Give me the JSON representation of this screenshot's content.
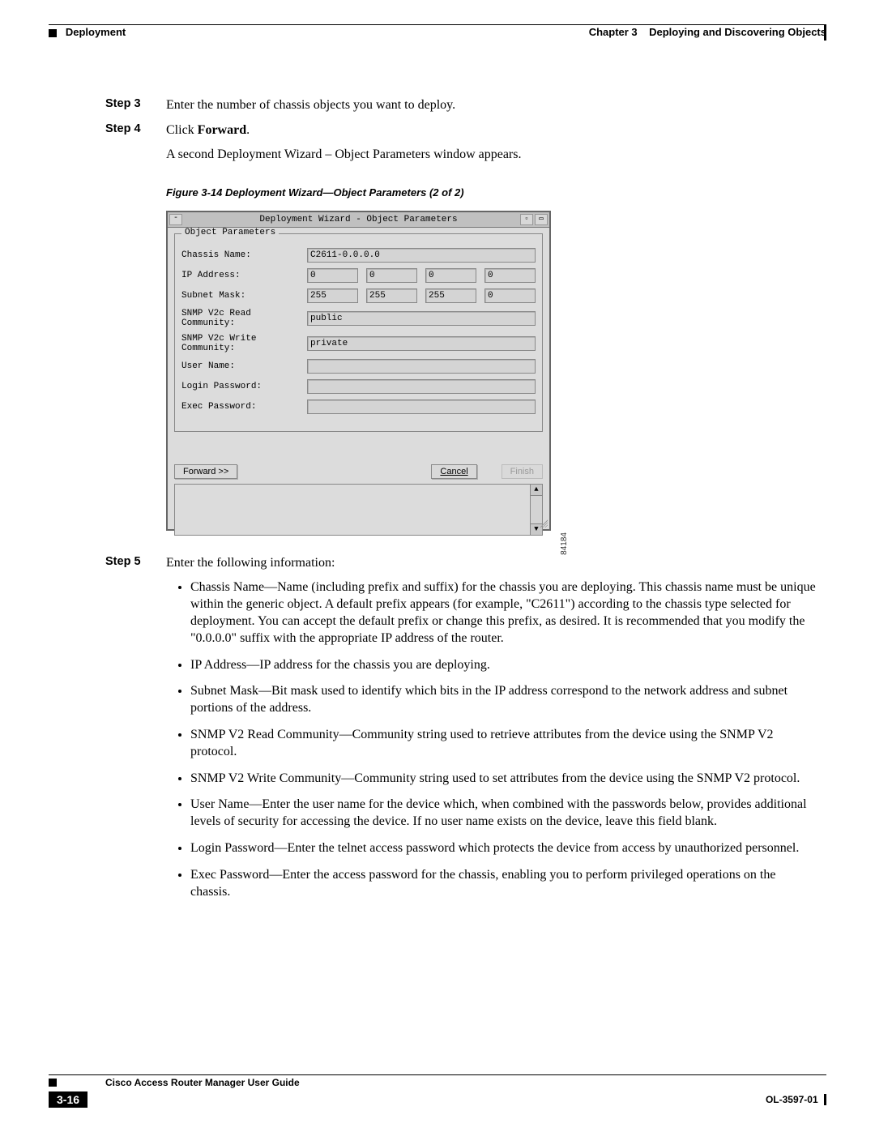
{
  "header": {
    "left": "Deployment",
    "right_chapter": "Chapter 3",
    "right_title": "Deploying and Discovering Objects"
  },
  "step3": {
    "label": "Step 3",
    "text": "Enter the number of chassis objects you want to deploy."
  },
  "step4": {
    "label": "Step 4",
    "prefix": "Click ",
    "bold": "Forward",
    "suffix": ".",
    "followup": "A second Deployment Wizard – Object Parameters window appears."
  },
  "figure": {
    "caption": "Figure 3-14   Deployment Wizard—Object Parameters (2 of 2)",
    "id": "84184",
    "window_title": "Deployment Wizard - Object Parameters",
    "legend": "Object Parameters",
    "labels": {
      "chassis": "Chassis Name:",
      "ip": "IP Address:",
      "mask": "Subnet Mask:",
      "snmp_r": "SNMP V2c Read Community:",
      "snmp_w": "SNMP V2c Write Community:",
      "user": "User Name:",
      "login": "Login Password:",
      "exec": "Exec Password:"
    },
    "values": {
      "chassis": "C2611-0.0.0.0",
      "ip": [
        "0",
        "0",
        "0",
        "0"
      ],
      "mask": [
        "255",
        "255",
        "255",
        "0"
      ],
      "snmp_r": "public",
      "snmp_w": "private",
      "user": "",
      "login": "",
      "exec": ""
    },
    "buttons": {
      "forward": "Forward >>",
      "cancel": "Cancel",
      "finish": "Finish"
    }
  },
  "step5": {
    "label": "Step 5",
    "text": "Enter the following information:",
    "bullets": [
      "Chassis Name—Name (including prefix and suffix) for the chassis you are deploying. This chassis name must be unique within the generic object. A default prefix appears (for example, \"C2611\") according to the chassis type selected for deployment. You can accept the default prefix or change this prefix, as desired. It is recommended that you modify the \"0.0.0.0\" suffix with the appropriate IP address of the router.",
      "IP Address—IP address for the chassis you are deploying.",
      "Subnet Mask—Bit mask used to identify which bits in the IP address correspond to the network address and subnet portions of the address.",
      "SNMP V2 Read Community—Community string used to retrieve attributes from the device using the SNMP V2 protocol.",
      "SNMP V2 Write Community—Community string used to set attributes from the device using the SNMP V2 protocol.",
      "User Name—Enter the user name for the device which, when combined with the passwords below, provides additional levels of security for accessing the device. If no user name exists on the device, leave this field blank.",
      "Login Password—Enter the telnet access password which protects the device from access by unauthorized personnel.",
      "Exec Password—Enter the access password for the chassis, enabling you to perform privileged operations on the chassis."
    ]
  },
  "footer": {
    "title": "Cisco Access Router Manager User Guide",
    "page": "3-16",
    "docid": "OL-3597-01"
  }
}
